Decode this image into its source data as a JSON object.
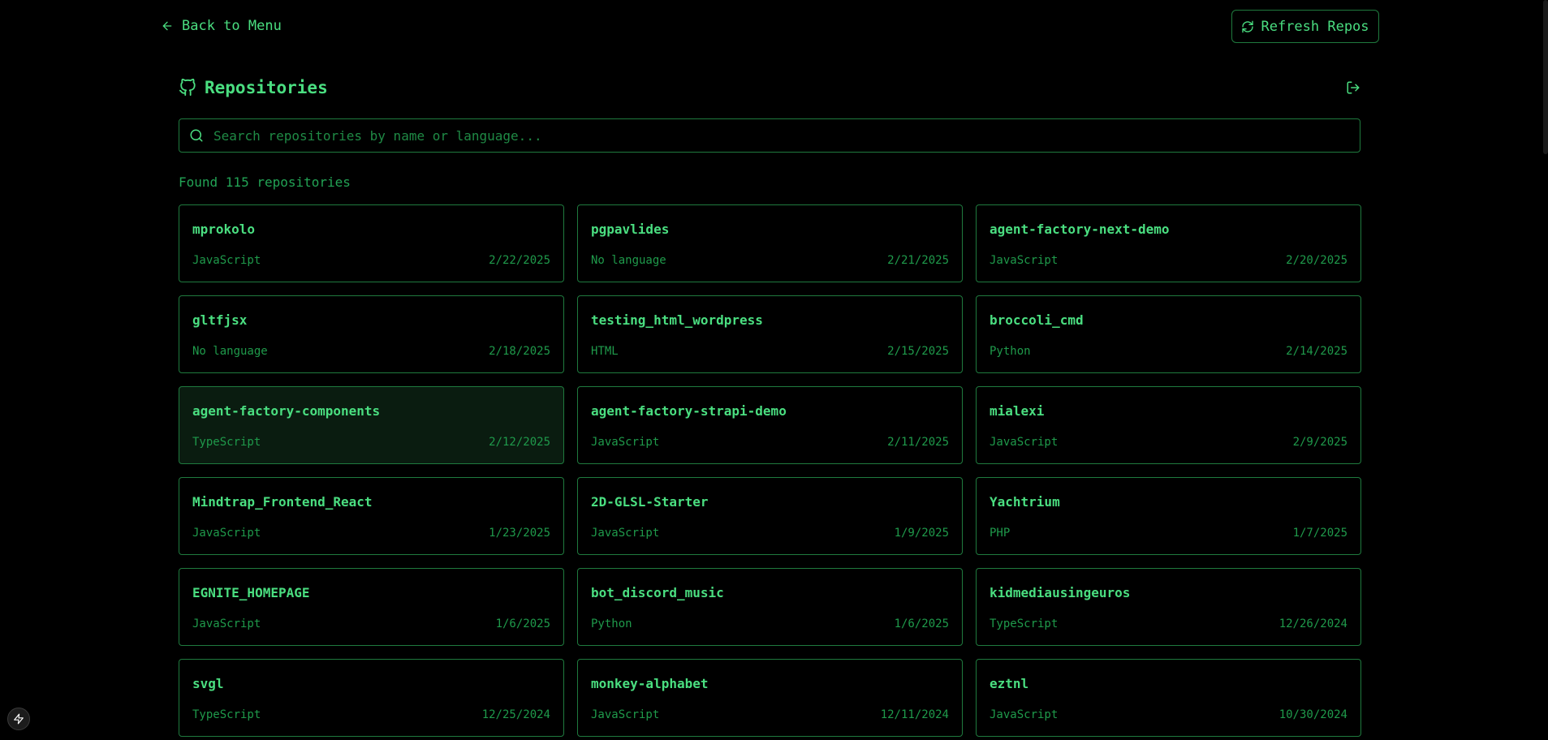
{
  "nav": {
    "back_label": "Back to Menu",
    "refresh_label": "Refresh Repos"
  },
  "header": {
    "title": "Repositories"
  },
  "search": {
    "placeholder": "Search repositories by name or language...",
    "value": ""
  },
  "results": {
    "found_text": "Found 115 repositories"
  },
  "repos": [
    {
      "name": "mprokolo",
      "language": "JavaScript",
      "date": "2/22/2025"
    },
    {
      "name": "pgpavlides",
      "language": "No language",
      "date": "2/21/2025"
    },
    {
      "name": "agent-factory-next-demo",
      "language": "JavaScript",
      "date": "2/20/2025"
    },
    {
      "name": "gltfjsx",
      "language": "No language",
      "date": "2/18/2025"
    },
    {
      "name": "testing_html_wordpress",
      "language": "HTML",
      "date": "2/15/2025"
    },
    {
      "name": "broccoli_cmd",
      "language": "Python",
      "date": "2/14/2025"
    },
    {
      "name": "agent-factory-components",
      "language": "TypeScript",
      "date": "2/12/2025"
    },
    {
      "name": "agent-factory-strapi-demo",
      "language": "JavaScript",
      "date": "2/11/2025"
    },
    {
      "name": "mialexi",
      "language": "JavaScript",
      "date": "2/9/2025"
    },
    {
      "name": "Mindtrap_Frontend_React",
      "language": "JavaScript",
      "date": "1/23/2025"
    },
    {
      "name": "2D-GLSL-Starter",
      "language": "JavaScript",
      "date": "1/9/2025"
    },
    {
      "name": "Yachtrium",
      "language": "PHP",
      "date": "1/7/2025"
    },
    {
      "name": "EGNITE_HOMEPAGE",
      "language": "JavaScript",
      "date": "1/6/2025"
    },
    {
      "name": "bot_discord_music",
      "language": "Python",
      "date": "1/6/2025"
    },
    {
      "name": "kidmediausingeuros",
      "language": "TypeScript",
      "date": "12/26/2024"
    },
    {
      "name": "svgl",
      "language": "TypeScript",
      "date": "12/25/2024"
    },
    {
      "name": "monkey-alphabet",
      "language": "JavaScript",
      "date": "12/11/2024"
    },
    {
      "name": "eztnl",
      "language": "JavaScript",
      "date": "10/30/2024"
    }
  ],
  "icons": {
    "back": "arrow-left-icon",
    "refresh": "refresh-icon",
    "github": "github-icon",
    "logout": "logout-icon",
    "search": "search-icon",
    "fab": "lightning-icon"
  },
  "colors": {
    "background": "#000000",
    "accent": "#4ade80",
    "border": "#1f7a3e",
    "muted": "#1f9a4b",
    "hover_bg": "#0a1c10"
  }
}
